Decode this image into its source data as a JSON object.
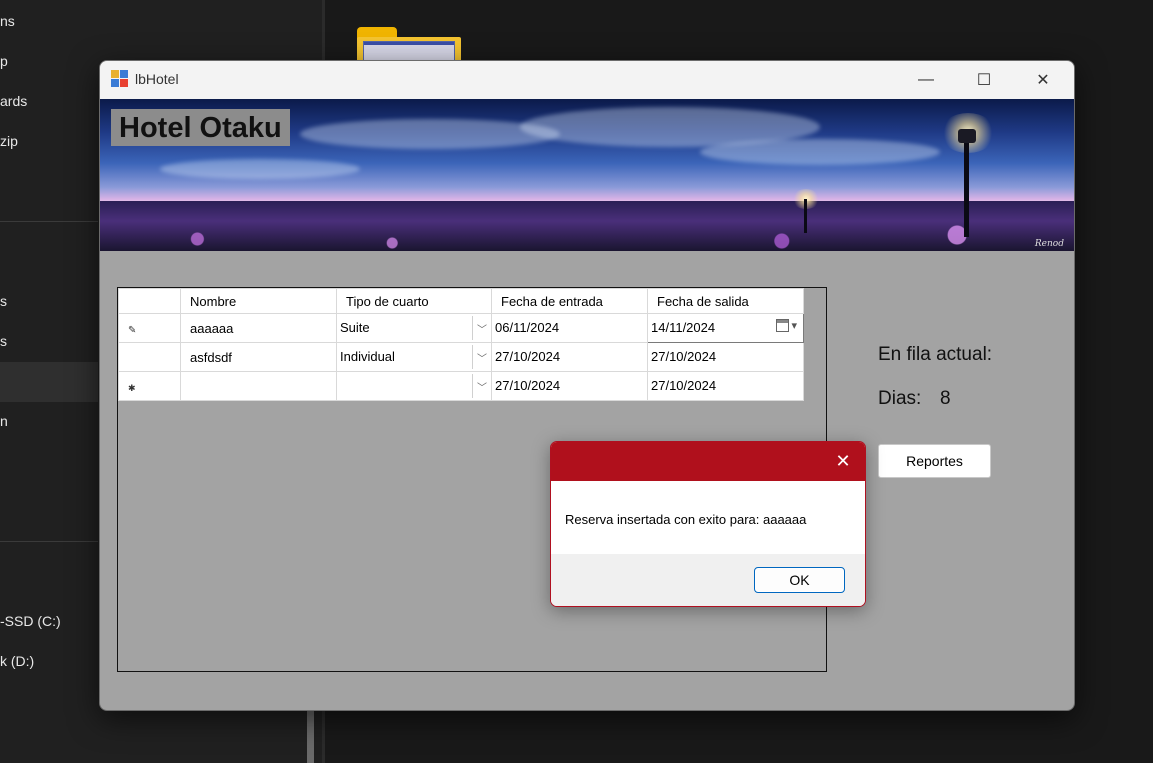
{
  "background": {
    "sidebar_items": [
      "ns",
      "p",
      "ards",
      "zip",
      "s",
      "s",
      "n",
      "-SSD (C:)",
      "k (D:)"
    ]
  },
  "window": {
    "title": "lbHotel",
    "minimize_glyph": "—",
    "maximize_glyph": "☐",
    "close_glyph": "✕"
  },
  "banner": {
    "title": "Hotel Otaku",
    "signature": "Renod"
  },
  "grid": {
    "columns": [
      "Nombre",
      "Tipo de cuarto",
      "Fecha de entrada",
      "Fecha de salida"
    ],
    "rows": [
      {
        "marker": "✎",
        "nombre": "aaaaaa",
        "tipo": "Suite",
        "entrada": "06/11/2024",
        "salida": "14/11/2024"
      },
      {
        "marker": "",
        "nombre": "asfdsdf",
        "tipo": "Individual",
        "entrada": "27/10/2024",
        "salida": "27/10/2024"
      },
      {
        "marker": "✱",
        "nombre": "",
        "tipo": "",
        "entrada": "27/10/2024",
        "salida": "27/10/2024"
      }
    ]
  },
  "side": {
    "fila_label": "En fila actual:",
    "dias_label": "Dias:",
    "dias_value": "8",
    "reportes_button": "Reportes"
  },
  "dialog": {
    "message": "Reserva insertada con exito para: aaaaaa",
    "ok_label": "OK",
    "accent_color": "#b0101c"
  }
}
